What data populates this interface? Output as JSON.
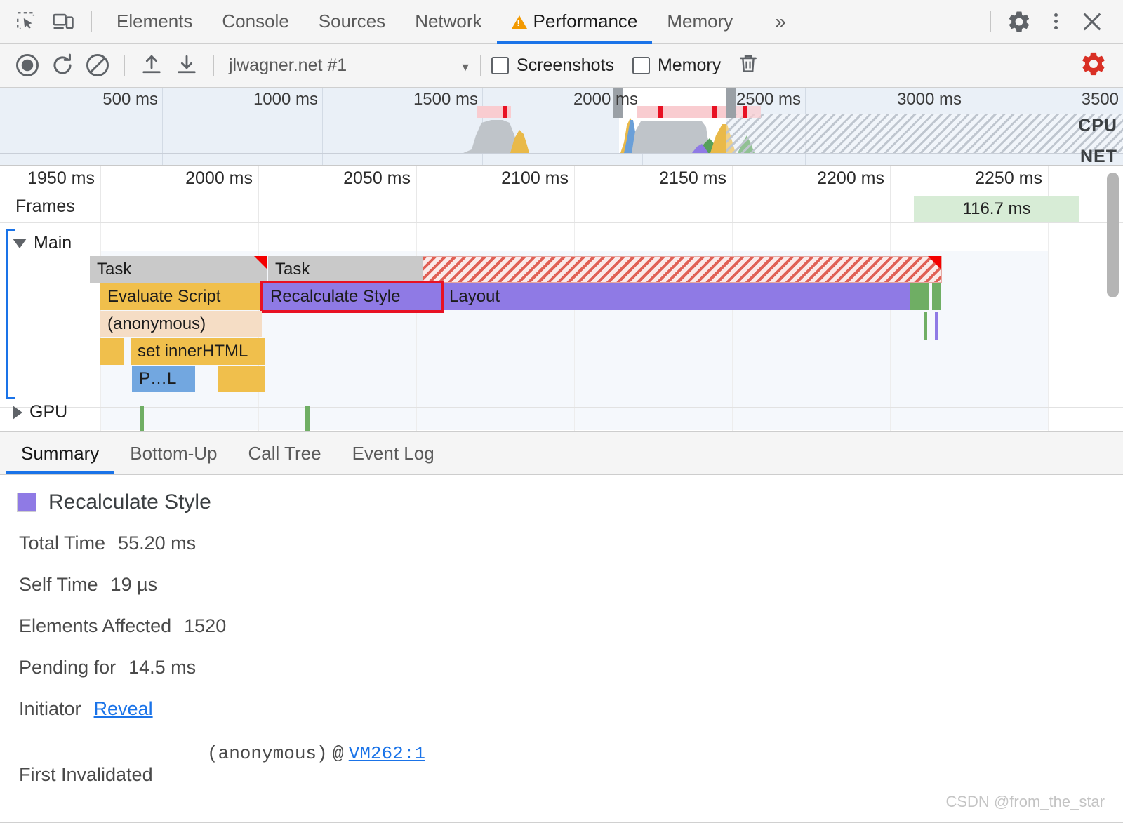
{
  "devtools": {
    "top_tabs": [
      {
        "id": "elements",
        "label": "Elements",
        "active": false,
        "warn": false
      },
      {
        "id": "console",
        "label": "Console",
        "active": false,
        "warn": false
      },
      {
        "id": "sources",
        "label": "Sources",
        "active": false,
        "warn": false
      },
      {
        "id": "network",
        "label": "Network",
        "active": false,
        "warn": false
      },
      {
        "id": "performance",
        "label": "Performance",
        "active": true,
        "warn": true
      },
      {
        "id": "memory",
        "label": "Memory",
        "active": false,
        "warn": false
      }
    ],
    "more_tabs_label": "»",
    "icons": {
      "inspect": "inspect-element-icon",
      "device": "device-toolbar-icon",
      "settings": "settings-gear-icon",
      "more": "more-options-kebab-icon",
      "close": "close-icon"
    }
  },
  "controls": {
    "record_label": "record-button",
    "reload_label": "reload-and-record-button",
    "clear_label": "clear-recording-button",
    "upload_label": "load-profile-button",
    "download_label": "save-profile-button",
    "session_name": "jlwagner.net #1",
    "session_caret": "▼",
    "screenshots_label": "Screenshots",
    "screenshots_checked": false,
    "memory_label": "Memory",
    "memory_checked": false,
    "trash_label": "collect-garbage-button",
    "capture_settings_label": "capture-settings-button",
    "capture_settings_color": "#d93025"
  },
  "overview": {
    "ticks": [
      "500 ms",
      "1000 ms",
      "1500 ms",
      "2000 ms",
      "2500 ms",
      "3000 ms",
      "3500"
    ],
    "lane_labels": [
      "CPU",
      "NET"
    ],
    "selection_start_label": "2000 ms",
    "selection_end_label": "2500 ms"
  },
  "detail_ruler": {
    "ticks": [
      "1950 ms",
      "2000 ms",
      "2050 ms",
      "2100 ms",
      "2150 ms",
      "2200 ms",
      "2250 ms"
    ]
  },
  "frames": {
    "label": "Frames",
    "entries": [
      {
        "duration": "116.7 ms"
      }
    ]
  },
  "tracks": [
    {
      "id": "main",
      "label": "Main",
      "expanded": true,
      "arrow": "▼"
    },
    {
      "id": "gpu",
      "label": "GPU",
      "expanded": false,
      "arrow": "▶"
    }
  ],
  "flame_events": [
    {
      "id": "task1",
      "label": "Task",
      "type": "task",
      "depth": 0
    },
    {
      "id": "task2",
      "label": "Task",
      "type": "task",
      "depth": 0
    },
    {
      "id": "task3",
      "label": "",
      "type": "task-long",
      "depth": 0
    },
    {
      "id": "eval",
      "label": "Evaluate Script",
      "type": "scripting",
      "depth": 1
    },
    {
      "id": "recalc",
      "label": "Recalculate Style",
      "type": "rendering",
      "depth": 1,
      "selected": true
    },
    {
      "id": "layout",
      "label": "Layout",
      "type": "rendering",
      "depth": 1
    },
    {
      "id": "anon",
      "label": "(anonymous)",
      "type": "scripting-light",
      "depth": 2
    },
    {
      "id": "innerhtml",
      "label": "set innerHTML",
      "type": "scripting",
      "depth": 3
    },
    {
      "id": "pl",
      "label": "P…L",
      "type": "parse",
      "depth": 4
    }
  ],
  "bottom_tabs": [
    {
      "id": "summary",
      "label": "Summary",
      "active": true
    },
    {
      "id": "bottom-up",
      "label": "Bottom-Up",
      "active": false
    },
    {
      "id": "call-tree",
      "label": "Call Tree",
      "active": false
    },
    {
      "id": "event-log",
      "label": "Event Log",
      "active": false
    }
  ],
  "summary": {
    "event_title": "Recalculate Style",
    "swatch_color": "#8f7ae5",
    "rows": [
      {
        "label": "Total Time",
        "value": "55.20 ms"
      },
      {
        "label": "Self Time",
        "value": "19 µs"
      },
      {
        "label": "Elements Affected",
        "value": "1520"
      },
      {
        "label": "Pending for",
        "value": "14.5 ms"
      }
    ],
    "initiator_label": "Initiator",
    "initiator_link": "Reveal",
    "first_invalidated_label": "First Invalidated",
    "first_invalidated_fn": "(anonymous)",
    "first_invalidated_at": "@",
    "first_invalidated_link": "VM262:1"
  },
  "watermark": "CSDN @from_the_star"
}
